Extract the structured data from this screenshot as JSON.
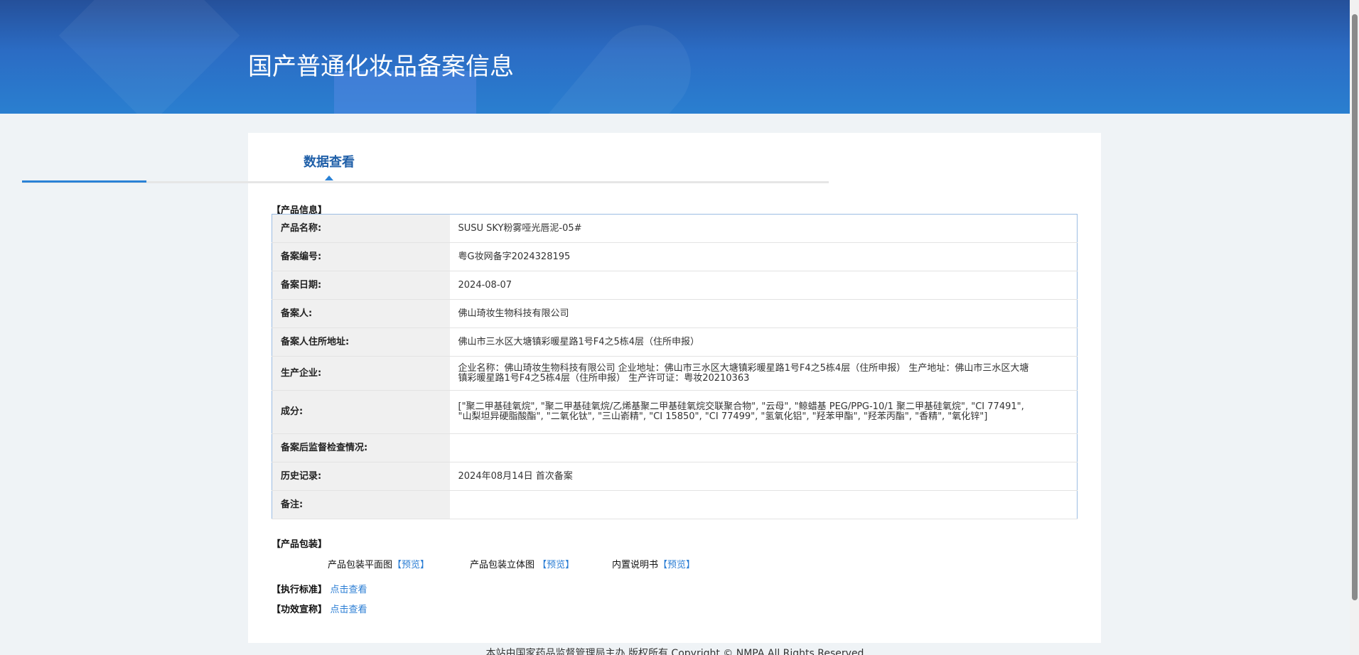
{
  "header": {
    "title": "国产普通化妆品备案信息"
  },
  "tab": {
    "label": "数据查看"
  },
  "product_info": {
    "section_label": "【产品信息】",
    "rows": [
      {
        "label": "产品名称:",
        "value": "SUSU SKY粉雾哑光唇泥-05#"
      },
      {
        "label": "备案编号:",
        "value": "粤G妆网备字2024328195"
      },
      {
        "label": "备案日期:",
        "value": "2024-08-07"
      },
      {
        "label": "备案人:",
        "value": "佛山琦妆生物科技有限公司"
      },
      {
        "label": "备案人住所地址:",
        "value": "佛山市三水区大塘镇彩暖星路1号F4之5栋4层（住所申报）"
      },
      {
        "label": "生产企业:",
        "value": "企业名称：佛山琦妆生物科技有限公司 企业地址：佛山市三水区大塘镇彩暖星路1号F4之5栋4层（住所申报） 生产地址：佛山市三水区大塘镇彩暖星路1号F4之5栋4层（住所申报） 生产许可证：粤妆20210363"
      },
      {
        "label": "成分:",
        "value": "[\"聚二甲基硅氧烷\", \"聚二甲基硅氧烷/乙烯基聚二甲基硅氧烷交联聚合物\", \"云母\", \"鲸蜡基 PEG/PPG-10/1 聚二甲基硅氧烷\", \"CI 77491\", \"山梨坦异硬脂酸酯\", \"二氧化钛\", \"三山嵛精\", \"CI 15850\", \"CI 77499\", \"氢氧化铝\", \"羟苯甲酯\", \"羟苯丙酯\", \"香精\", \"氧化锌\"]"
      },
      {
        "label": "备案后监督检查情况:",
        "value": ""
      },
      {
        "label": "历史记录:",
        "value": "2024年08月14日 首次备案"
      },
      {
        "label": "备注:",
        "value": ""
      }
    ]
  },
  "packaging": {
    "section_label": "【产品包装】",
    "items": [
      {
        "label": "产品包装平面图",
        "link": "【预览】"
      },
      {
        "label": "产品包装立体图 ",
        "link": "【预览】"
      },
      {
        "label": "内置说明书",
        "link": "【预览】"
      }
    ]
  },
  "standard": {
    "label": "【执行标准】",
    "link": "点击查看"
  },
  "efficacy": {
    "label": "【功效宣称】",
    "link": "点击查看"
  },
  "footer": {
    "text": "本站由国家药品监督管理局主办 版权所有 Copyright © NMPA All Rights Reserved"
  }
}
